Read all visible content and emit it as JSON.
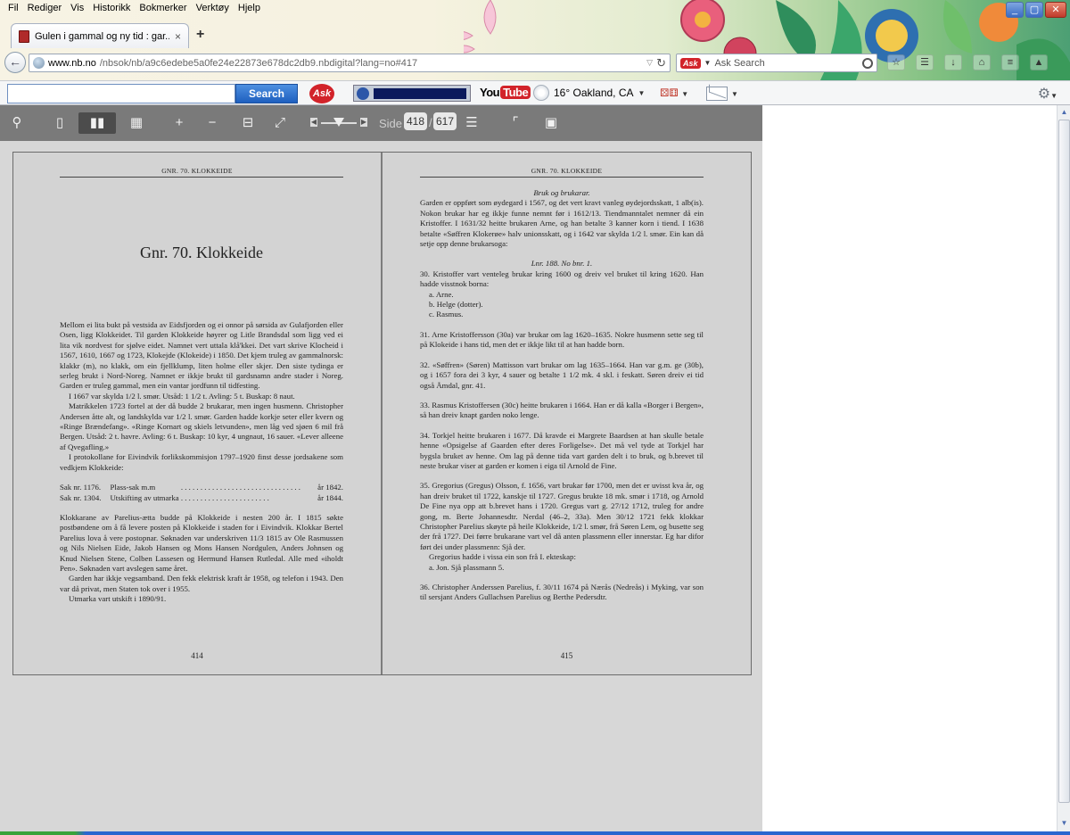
{
  "menu": [
    "Fil",
    "Rediger",
    "Vis",
    "Historikk",
    "Bokmerker",
    "Verktøy",
    "Hjelp"
  ],
  "window_buttons": [
    "_",
    "▢",
    "✕"
  ],
  "tab": {
    "title": "Gulen i gammal og ny tid : gar...",
    "close": "×",
    "new": "+"
  },
  "address": {
    "host": "www.nb.no",
    "path": "/nbsok/nb/a9c6edebe5a0fe24e22873e678dc2db9.nbdigital?lang=no#417"
  },
  "ask_search": {
    "badge": "Ask",
    "placeholder": "Ask Search"
  },
  "toolbar": {
    "search_label": "Search",
    "ask_logo": "Ask",
    "youtube_you": "You",
    "youtube_tube": "Tube",
    "weather": "16° Oakland, CA"
  },
  "viewer": {
    "side_label": "Side",
    "current_page": "418",
    "total_pages": "617"
  },
  "left_page": {
    "running_head": "GNR. 70. KLOKKEIDE",
    "chapter_title": "Gnr. 70. Klokkeide",
    "paragraphs": [
      "Mellom ei lita bukt på vestsida av Eidsfjorden og ei onnor på sørsida av Gulafjorden eller Osen, ligg Klokkeidet. Til garden Klokkeide høyrer og Litle Brandsdal som ligg ved ei lita vik nordvest for sjølve eidet. Namnet vert uttala klå'kkei. Det vart skrive Klocheid i 1567, 1610, 1667 og 1723, Klokejde (Klokeide) i 1850. Det kjem truleg av gammalnorsk: klakkr (m), no klakk, om ein fjellklump, liten holme eller skjer. Den siste tydinga er serleg brukt i Nord-Noreg. Namnet er ikkje brukt til gardsnamn andre stader i Noreg. Garden er truleg gammal, men ein vantar jordfunn til tidfesting.",
      "I 1667 var skylda 1/2 l. smør. Utsåd: 1 1/2 t. Avling: 5 t. Buskap: 8 naut.",
      "Matrikkelen 1723 fortel at der då budde 2 brukarar, men ingen husmenn. Christopher Andersen åtte alt, og landskylda var 1/2 l. smør. Garden hadde korkje seter eller kvern og «Ringe Brændefang». «Ringe Kornart og skiels letvunden», men låg ved sjøen 6 mil frå Bergen. Utsåd: 2 t. havre. Avling: 6 t. Buskap: 10 kyr, 4 ungnaut, 16 sauer. «Lever alleene af Qvegafling.»",
      "I protokollane for Eivindvik forlikskommisjon 1797–1920 finst desse jordsakene som vedkjem Klokkeide:"
    ],
    "sak_rows": [
      {
        "nr": "Sak nr. 1176.",
        "desc": "Plass-sak m.m",
        "year": "år 1842."
      },
      {
        "nr": "Sak nr. 1304.",
        "desc": "Utskifting av utmarka",
        "year": "år 1844."
      }
    ],
    "paragraphs2": [
      "Klokkarane av Parelius-ætta budde på Klokkeide i nesten 200 år. I 1815 søkte postbøndene om å få levere posten på Klokkeide i staden for i Eivindvik. Klokkar Bertel Parelius lova å vere postopnar. Søknaden var underskriven 11/3 1815 av Ole Rasmussen og Nils Nielsen Eide, Jakob Hansen og Mons Hansen Nordgulen, Anders Johnsen og Knud Nielsen Stene, Colben Lassesen og Hermund Hansen Rutledal. Alle med «iholdt Pen». Søknaden vart avslegen same året.",
      "Garden har ikkje vegsamband. Den fekk elektrisk kraft år 1958, og telefon i 1943. Den var då privat, men Staten tok over i 1955.",
      "Utmarka vart utskift i 1890/91."
    ],
    "folio": "414"
  },
  "right_page": {
    "running_head": "GNR. 70. KLOKKEIDE",
    "section_title": "Bruk og brukarar.",
    "intro": "Garden er oppført som øydegard i 1567, og det vert kravt vanleg øydejordsskatt, 1 alb(is). Nokon brukar har eg ikkje funne nemnt før i 1612/13. Tiendmanntalet nemner då ein Kristoffer. I 1631/32 heitte brukaren Arne, og han betalte 3 kanner korn i tiend. I 1638 betalte «Søffren Klokerøe» halv unionsskatt, og i 1642 var skylda 1/2 l. smør. Ein kan då setje opp denne brukarsoga:",
    "subsection": "Lnr. 188. No bnr. 1.",
    "entry30": "30. Kristoffer vart venteleg brukar kring 1600 og dreiv vel bruket til kring 1620. Han hadde visstnok borna:",
    "children30": [
      "a.  Arne.",
      "b.  Helge (dotter).",
      "c.  Rasmus."
    ],
    "entry31": "31. Arne Kristoffersson (30a) var brukar om lag 1620–1635. Nokre husmenn sette seg til på Klokeide i hans tid, men det er ikkje likt til at han hadde born.",
    "entry32": "32. «Søffren» (Søren) Mattisson vart brukar om lag 1635–1664. Han var g.m. ge (30b), og i 1657 fora dei 3 kyr, 4 sauer og betalte 1 1/2 mk. 4 skl. i feskatt. Søren dreiv ei tid også Åmdal, gnr. 41.",
    "entry33": "33. Rasmus Kristoffersen (30c) heitte brukaren i 1664. Han er då kalla «Borger i Bergen», så han dreiv knapt garden noko lenge.",
    "entry34": "34. Torkjel heitte brukaren i 1677. Då kravde ei Margrete Baardsen at han skulle betale henne «Opsigelse af Gaarden efter deres Forligelse». Det må vel tyde at Torkjel har bygsla bruket av henne. Om lag på denne tida vart garden delt i to bruk, og b.brevet til neste brukar viser at garden er komen i eiga til Arnold de Fine.",
    "entry35": "35. Gregorius (Gregus) Olsson, f. 1656, vart brukar før 1700, men det er uvisst kva år, og han dreiv bruket til 1722, kanskje til 1727. Gregus brukte 18 mk. smør i 1718, og Arnold De Fine nya opp att b.brevet hans i 1720. Gregus vart g. 27/12 1712, truleg for andre gong, m. Berte Johannesdtr. Nerdal (46–2, 33a). Men 30/12 1721 fekk klokkar Christopher Parelius skøyte på heile Klokkeide, 1/2 l. smør, frå Søren Lem, og busette seg der frå 1727. Dei førre brukarane vart vel då anten plassmenn eller innerstar. Eg har difor ført dei under plassmenn: Sjå der.",
    "entry35b": "Gregorius hadde i vissa ein son frå I. ekteskap:",
    "children35": [
      "a.  Jon. Sjå plassmann 5."
    ],
    "entry36": "36. Christopher Anderssen Parelius, f. 30/11 1674 på Nærås (Nedreås) i Myking, var son til sersjant Anders Gullachsen Parelius og Berthe Pedersdtr.",
    "folio": "415"
  }
}
